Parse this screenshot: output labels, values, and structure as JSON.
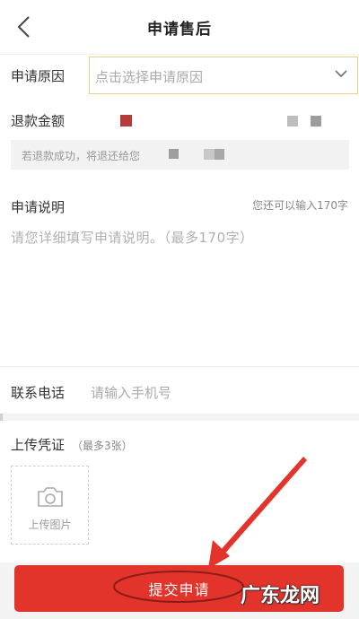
{
  "header": {
    "title": "申请售后",
    "back_icon": "chevron-left-icon"
  },
  "reason": {
    "label": "申请原因",
    "placeholder": "点击选择申请原因",
    "dropdown_icon": "chevron-down-icon"
  },
  "refund": {
    "label": "退款金额",
    "note": "若退款成功，将退还给您"
  },
  "description": {
    "label": "申请说明",
    "remaining": "您还可以输入170字",
    "placeholder": "请您详细填写申请说明。（最多170字）"
  },
  "phone": {
    "label": "联系电话",
    "placeholder": "请输入手机号"
  },
  "upload": {
    "label": "上传凭证",
    "max_note": "（最多3张）",
    "button_label": "上传图片",
    "camera_icon": "camera-icon"
  },
  "submit": {
    "label": "提交申请"
  },
  "watermark": {
    "text": "广东龙网"
  },
  "colors": {
    "accent_red": "#e3342c",
    "highlight_border": "#e7d08a",
    "background": "#f3f3f3"
  }
}
